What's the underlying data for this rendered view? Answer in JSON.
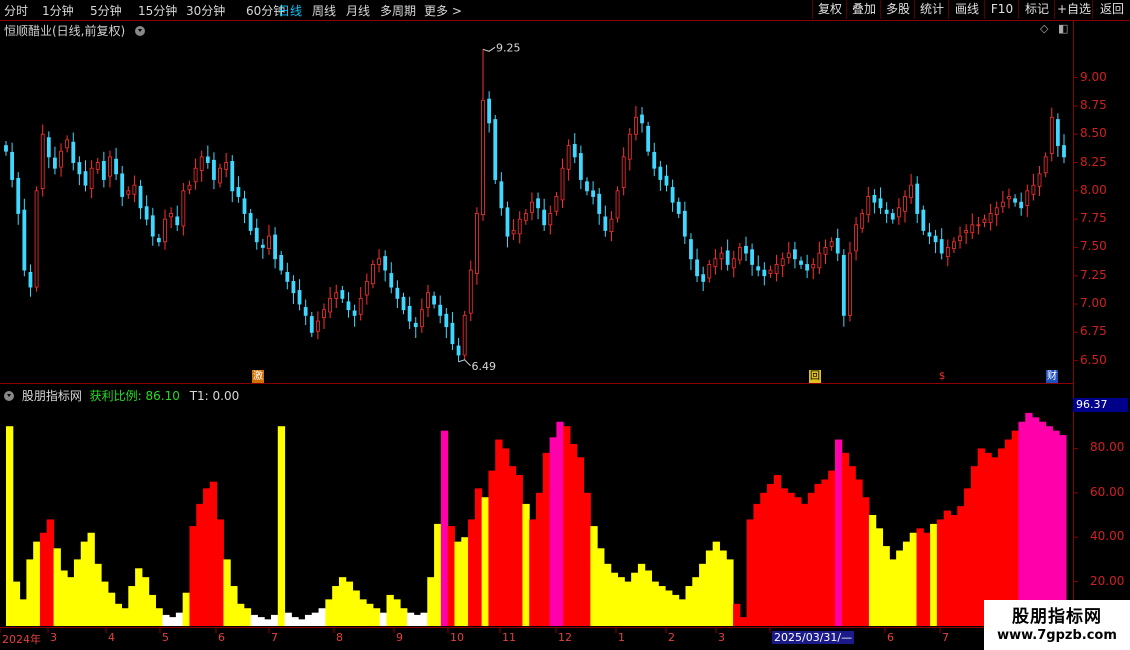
{
  "toolbar": {
    "periods": [
      "分时",
      "1分钟",
      "5分钟",
      "15分钟",
      "30分钟",
      "60分钟",
      "日线",
      "周线",
      "月线",
      "多周期",
      "更多 >"
    ],
    "active_period": "日线",
    "right_buttons": [
      "复权",
      "叠加",
      "多股",
      "统计",
      "画线",
      "F10",
      "标记",
      "+自选",
      "返回"
    ]
  },
  "price_panel": {
    "title": "恒顺醋业(日线,前复权)",
    "high_label": "9.25",
    "low_label": "6.49",
    "axis_ticks": [
      "9.00",
      "8.75",
      "8.50",
      "8.25",
      "8.00",
      "7.75",
      "7.50",
      "7.25",
      "7.00",
      "6.75",
      "6.50"
    ],
    "markers": [
      "激",
      "回",
      "$",
      "财"
    ]
  },
  "indicator_panel": {
    "name": "股朋指标网",
    "ratio_label": "获利比例: 86.10",
    "t1_label": "T1: 0.00",
    "current_value": "96.37",
    "axis_ticks": [
      "80.00",
      "60.00",
      "40.00",
      "20.00"
    ]
  },
  "date_axis": {
    "ticks": [
      "2024年",
      "3",
      "4",
      "5",
      "6",
      "7",
      "8",
      "9",
      "10",
      "11",
      "12",
      "1",
      "2",
      "3",
      "2025/03/31/—",
      "6",
      "7"
    ],
    "highlighted": "2025/03/31/—"
  },
  "watermark": {
    "title": "股朋指标网",
    "url": "www.7gpzb.com"
  },
  "colors": {
    "up": "#ff3030",
    "down": "#40d8ff",
    "frame": "#8b0000",
    "ind_yellow": "#ffff00",
    "ind_red": "#ff0000",
    "ind_magenta": "#ff00aa",
    "ind_white": "#ffffff"
  },
  "chart_data": [
    {
      "type": "candlestick",
      "title": "恒顺醋业(日线,前复权)",
      "ylim": [
        6.4,
        9.35
      ],
      "annotations": [
        {
          "label": "9.25",
          "value": 9.25
        },
        {
          "label": "6.49",
          "value": 6.49
        }
      ],
      "close": [
        8.35,
        8.1,
        7.8,
        7.3,
        7.15,
        8.0,
        8.5,
        8.3,
        8.2,
        8.35,
        8.45,
        8.25,
        8.15,
        8.05,
        8.2,
        8.25,
        8.1,
        8.3,
        8.15,
        7.95,
        8.0,
        8.05,
        7.85,
        7.75,
        7.6,
        7.55,
        7.75,
        7.8,
        7.7,
        8.0,
        8.05,
        8.2,
        8.3,
        8.25,
        8.1,
        8.2,
        8.25,
        8.0,
        7.95,
        7.8,
        7.65,
        7.55,
        7.5,
        7.6,
        7.4,
        7.3,
        7.2,
        7.1,
        7.0,
        6.9,
        6.75,
        6.85,
        6.95,
        7.05,
        7.1,
        7.05,
        6.95,
        6.9,
        7.05,
        7.2,
        7.35,
        7.4,
        7.3,
        7.15,
        7.05,
        6.95,
        6.85,
        6.8,
        6.95,
        7.1,
        7.0,
        6.9,
        6.8,
        6.65,
        6.55,
        6.9,
        7.3,
        7.8,
        8.8,
        8.6,
        8.1,
        7.85,
        7.6,
        7.65,
        7.75,
        7.8,
        7.9,
        7.85,
        7.7,
        7.8,
        7.95,
        8.2,
        8.4,
        8.3,
        8.1,
        8.0,
        7.95,
        7.8,
        7.65,
        7.75,
        8.0,
        8.3,
        8.5,
        8.65,
        8.6,
        8.35,
        8.2,
        8.1,
        8.05,
        7.9,
        7.8,
        7.6,
        7.4,
        7.25,
        7.2,
        7.35,
        7.4,
        7.45,
        7.35,
        7.4,
        7.5,
        7.45,
        7.35,
        7.3,
        7.25,
        7.3,
        7.35,
        7.4,
        7.45,
        7.4,
        7.35,
        7.3,
        7.35,
        7.45,
        7.5,
        7.55,
        7.45,
        6.9,
        7.45,
        7.7,
        7.8,
        7.95,
        7.9,
        7.85,
        7.8,
        7.75,
        7.85,
        7.95,
        8.05,
        7.8,
        7.65,
        7.6,
        7.55,
        7.45,
        7.5,
        7.55,
        7.6,
        7.65,
        7.7,
        7.7,
        7.75,
        7.8,
        7.85,
        7.9,
        7.95,
        7.9,
        7.85,
        8.0,
        8.05,
        8.15,
        8.3,
        8.65,
        8.4,
        8.3
      ]
    },
    {
      "type": "bar",
      "title": "股朋指标网",
      "ylim": [
        0,
        100
      ],
      "annotations": [
        {
          "label": "获利比例",
          "value": 86.1
        },
        {
          "label": "T1",
          "value": 0.0
        },
        {
          "label": "current",
          "value": 96.37
        }
      ],
      "values": [
        90,
        20,
        12,
        30,
        38,
        42,
        48,
        35,
        25,
        22,
        30,
        38,
        42,
        28,
        20,
        15,
        10,
        8,
        18,
        26,
        22,
        14,
        8,
        5,
        4,
        6,
        15,
        45,
        55,
        62,
        65,
        48,
        30,
        18,
        10,
        8,
        5,
        4,
        3,
        5,
        90,
        6,
        4,
        3,
        5,
        6,
        8,
        12,
        18,
        22,
        20,
        16,
        12,
        10,
        8,
        6,
        14,
        12,
        8,
        6,
        5,
        6,
        22,
        46,
        88,
        45,
        38,
        40,
        48,
        62,
        58,
        70,
        84,
        80,
        72,
        68,
        55,
        48,
        60,
        78,
        85,
        92,
        90,
        82,
        76,
        60,
        45,
        35,
        28,
        24,
        22,
        20,
        24,
        28,
        25,
        20,
        18,
        16,
        14,
        12,
        18,
        22,
        28,
        34,
        38,
        34,
        30,
        10,
        4,
        48,
        55,
        60,
        64,
        68,
        62,
        60,
        58,
        55,
        60,
        64,
        66,
        70,
        84,
        78,
        72,
        66,
        58,
        50,
        44,
        36,
        30,
        34,
        38,
        42,
        44,
        42,
        46,
        48,
        52,
        50,
        54,
        62,
        72,
        80,
        78,
        76,
        80,
        84,
        88,
        92,
        96,
        94,
        92,
        90,
        88,
        86
      ],
      "colors": [
        "yellow",
        "yellow",
        "yellow",
        "yellow",
        "yellow",
        "red",
        "red",
        "yellow",
        "yellow",
        "yellow",
        "yellow",
        "yellow",
        "yellow",
        "yellow",
        "yellow",
        "yellow",
        "yellow",
        "yellow",
        "yellow",
        "yellow",
        "yellow",
        "yellow",
        "yellow",
        "white",
        "white",
        "white",
        "yellow",
        "red",
        "red",
        "red",
        "red",
        "red",
        "yellow",
        "yellow",
        "yellow",
        "yellow",
        "white",
        "white",
        "white",
        "white",
        "yellow",
        "white",
        "white",
        "white",
        "white",
        "white",
        "white",
        "yellow",
        "yellow",
        "yellow",
        "yellow",
        "yellow",
        "yellow",
        "yellow",
        "yellow",
        "white",
        "yellow",
        "yellow",
        "yellow",
        "white",
        "white",
        "white",
        "yellow",
        "yellow",
        "magenta",
        "red",
        "yellow",
        "yellow",
        "red",
        "red",
        "yellow",
        "red",
        "red",
        "red",
        "red",
        "red",
        "yellow",
        "red",
        "red",
        "red",
        "magenta",
        "magenta",
        "red",
        "red",
        "red",
        "red",
        "yellow",
        "yellow",
        "yellow",
        "yellow",
        "yellow",
        "yellow",
        "yellow",
        "yellow",
        "yellow",
        "yellow",
        "yellow",
        "yellow",
        "yellow",
        "yellow",
        "yellow",
        "yellow",
        "yellow",
        "yellow",
        "yellow",
        "yellow",
        "yellow",
        "red",
        "red",
        "red",
        "red",
        "red",
        "red",
        "red",
        "red",
        "red",
        "red",
        "red",
        "red",
        "red",
        "red",
        "red",
        "magenta",
        "red",
        "red",
        "red",
        "red",
        "yellow",
        "yellow",
        "yellow",
        "yellow",
        "yellow",
        "yellow",
        "yellow",
        "red",
        "red",
        "yellow",
        "red",
        "red",
        "red",
        "red",
        "red",
        "red",
        "red",
        "red",
        "red",
        "red",
        "red",
        "red",
        "magenta",
        "magenta",
        "magenta",
        "magenta",
        "magenta",
        "magenta",
        "magenta"
      ]
    }
  ]
}
